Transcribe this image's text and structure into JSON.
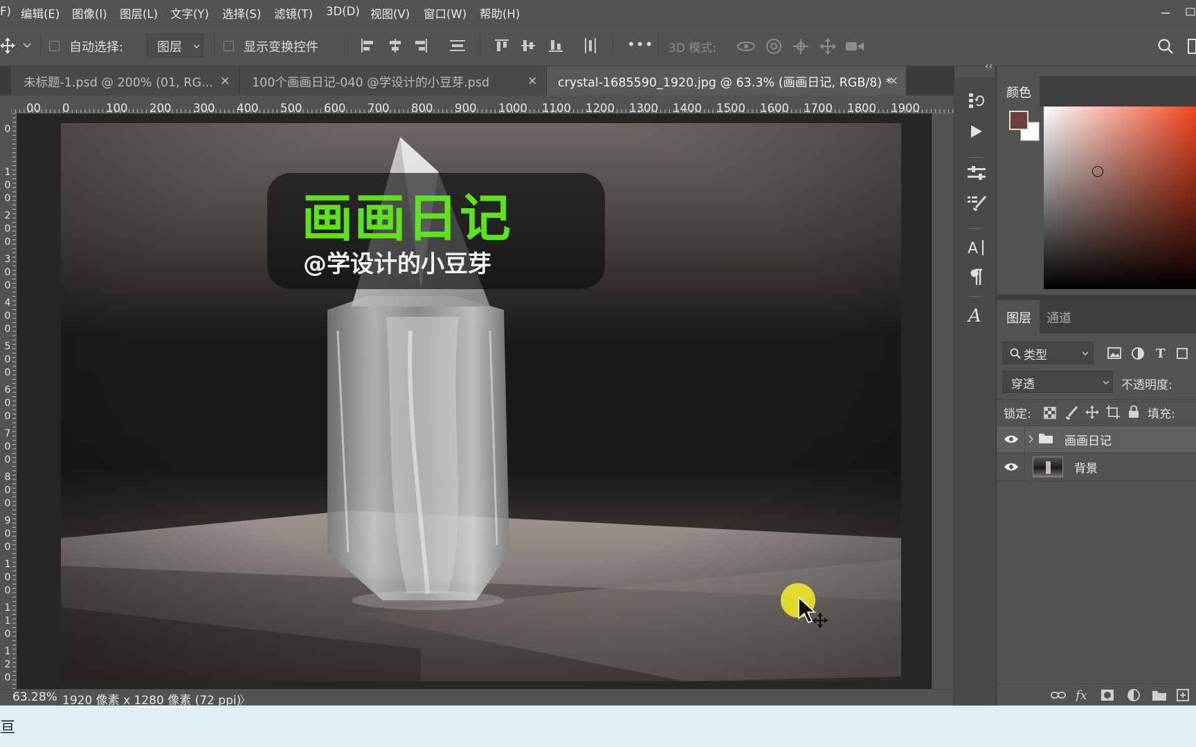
{
  "menubar": {
    "items": [
      "F)",
      "编辑(E)",
      "图像(I)",
      "图层(L)",
      "文字(Y)",
      "选择(S)",
      "滤镜(T)",
      "3D(D)",
      "视图(V)",
      "窗口(W)",
      "帮助(H)"
    ]
  },
  "options": {
    "auto_select_label": "自动选择:",
    "auto_select_value": "图层",
    "show_transform_label": "显示变换控件",
    "more_label": "•••",
    "mode_3d_label": "3D 模式:"
  },
  "tabs": [
    {
      "label": "未标题-1.psd @ 200% (01, RG...",
      "close": "×"
    },
    {
      "label": "100个画画日记-040 @学设计的小豆芽.psd",
      "close": "×"
    },
    {
      "label": "crystal-1685590_1920.jpg @ 63.3% (画画日记, RGB/8) *",
      "close": "×"
    }
  ],
  "ruler": {
    "h_ticks": [
      "00",
      "0",
      "100",
      "200",
      "300",
      "400",
      "500",
      "600",
      "700",
      "800",
      "900",
      "1000",
      "1100",
      "1200",
      "1300",
      "1400",
      "1500",
      "1600",
      "1700",
      "1800",
      "1900"
    ],
    "v_labels": [
      "0",
      "1\n0\n0",
      "2\n0\n0",
      "3\n0\n0",
      "4\n0\n0",
      "5\n0\n0",
      "6\n0\n0",
      "7\n0\n0",
      "8\n0\n0",
      "9\n0\n0",
      "1\n0\n0",
      "1\n1\n0",
      "1\n2\n0"
    ]
  },
  "canvas": {
    "title_text": "画画日记",
    "subtitle_text": "@学设计的小豆芽",
    "title_color": "#5ee21e"
  },
  "status": {
    "zoom": "63.28%",
    "doc_info": "1920 像素 x 1280 像素 (72 ppi)",
    "arrow": "〉"
  },
  "panels": {
    "collapse": "‹‹",
    "color_tab": "颜色",
    "layers_tab": "图层",
    "channels_tab": "通道",
    "filter_label": "类型",
    "blend_mode": "穿透",
    "opacity_label": "不透明度:",
    "lock_label": "锁定:",
    "fill_label": "填充:",
    "layers": [
      {
        "name": "画画日记",
        "type": "group"
      },
      {
        "name": "背景",
        "type": "image"
      }
    ],
    "foreground_color": "#6b4038",
    "background_color": "#ffffff"
  },
  "taskbar": {
    "fragment": "亘"
  }
}
